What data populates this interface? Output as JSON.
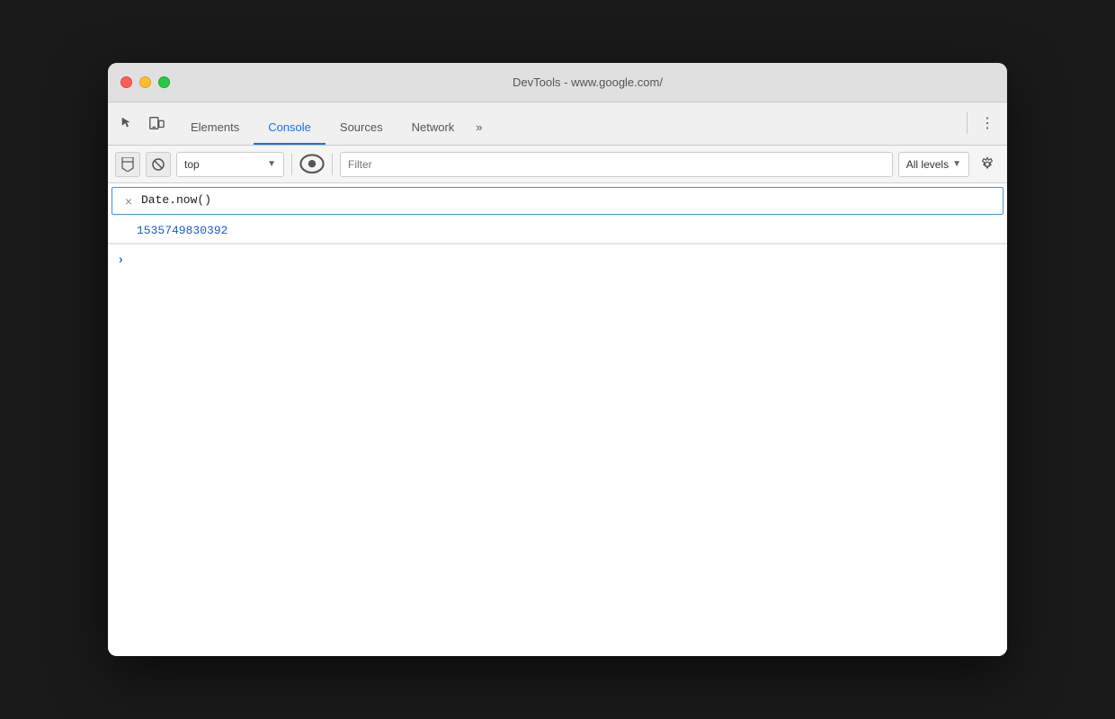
{
  "window": {
    "title": "DevTools - www.google.com/"
  },
  "traffic_lights": {
    "close_label": "close",
    "minimize_label": "minimize",
    "maximize_label": "maximize"
  },
  "tab_bar": {
    "tabs": [
      {
        "id": "elements",
        "label": "Elements",
        "active": false
      },
      {
        "id": "console",
        "label": "Console",
        "active": true
      },
      {
        "id": "sources",
        "label": "Sources",
        "active": false
      },
      {
        "id": "network",
        "label": "Network",
        "active": false
      }
    ],
    "more_label": "»",
    "menu_label": "⋮"
  },
  "toolbar": {
    "context_value": "top",
    "context_placeholder": "top",
    "filter_placeholder": "Filter",
    "levels_label": "All levels",
    "clear_tooltip": "Clear console"
  },
  "console": {
    "entries": [
      {
        "type": "input",
        "icon": "×",
        "text": "Date.now()"
      },
      {
        "type": "output",
        "text": "1535749830392"
      }
    ],
    "prompt_icon": "›"
  }
}
